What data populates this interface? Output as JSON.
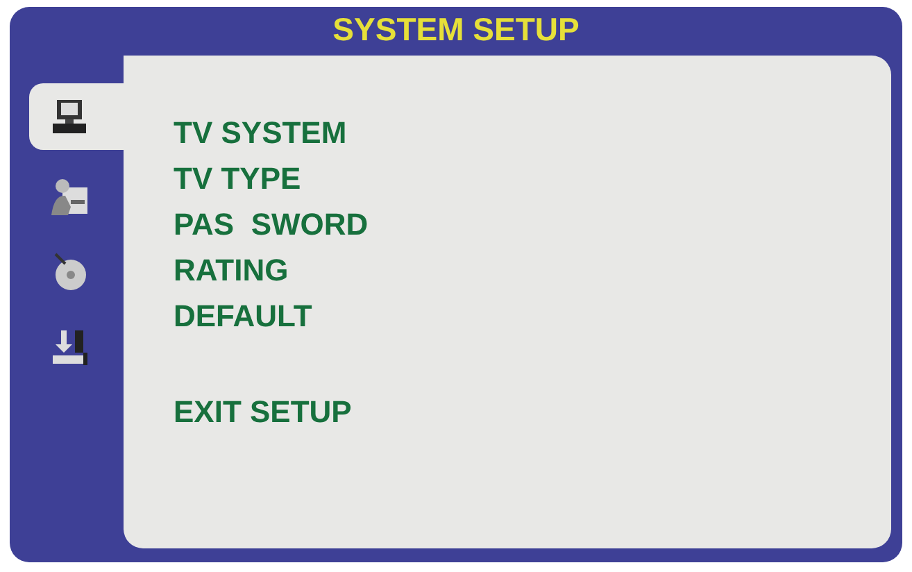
{
  "title": "SYSTEM SETUP",
  "tabs": [
    {
      "selected": true
    },
    {
      "selected": false
    },
    {
      "selected": false
    },
    {
      "selected": false
    }
  ],
  "menu": [
    {
      "label": "TV SYSTEM",
      "kind": "item"
    },
    {
      "label": "TV TYPE",
      "kind": "item"
    },
    {
      "label": "PAS  SWORD",
      "kind": "item"
    },
    {
      "label": "RATING",
      "kind": "item"
    },
    {
      "label": "DEFAULT",
      "kind": "item"
    },
    {
      "label": "EXIT SETUP",
      "kind": "exit"
    }
  ]
}
